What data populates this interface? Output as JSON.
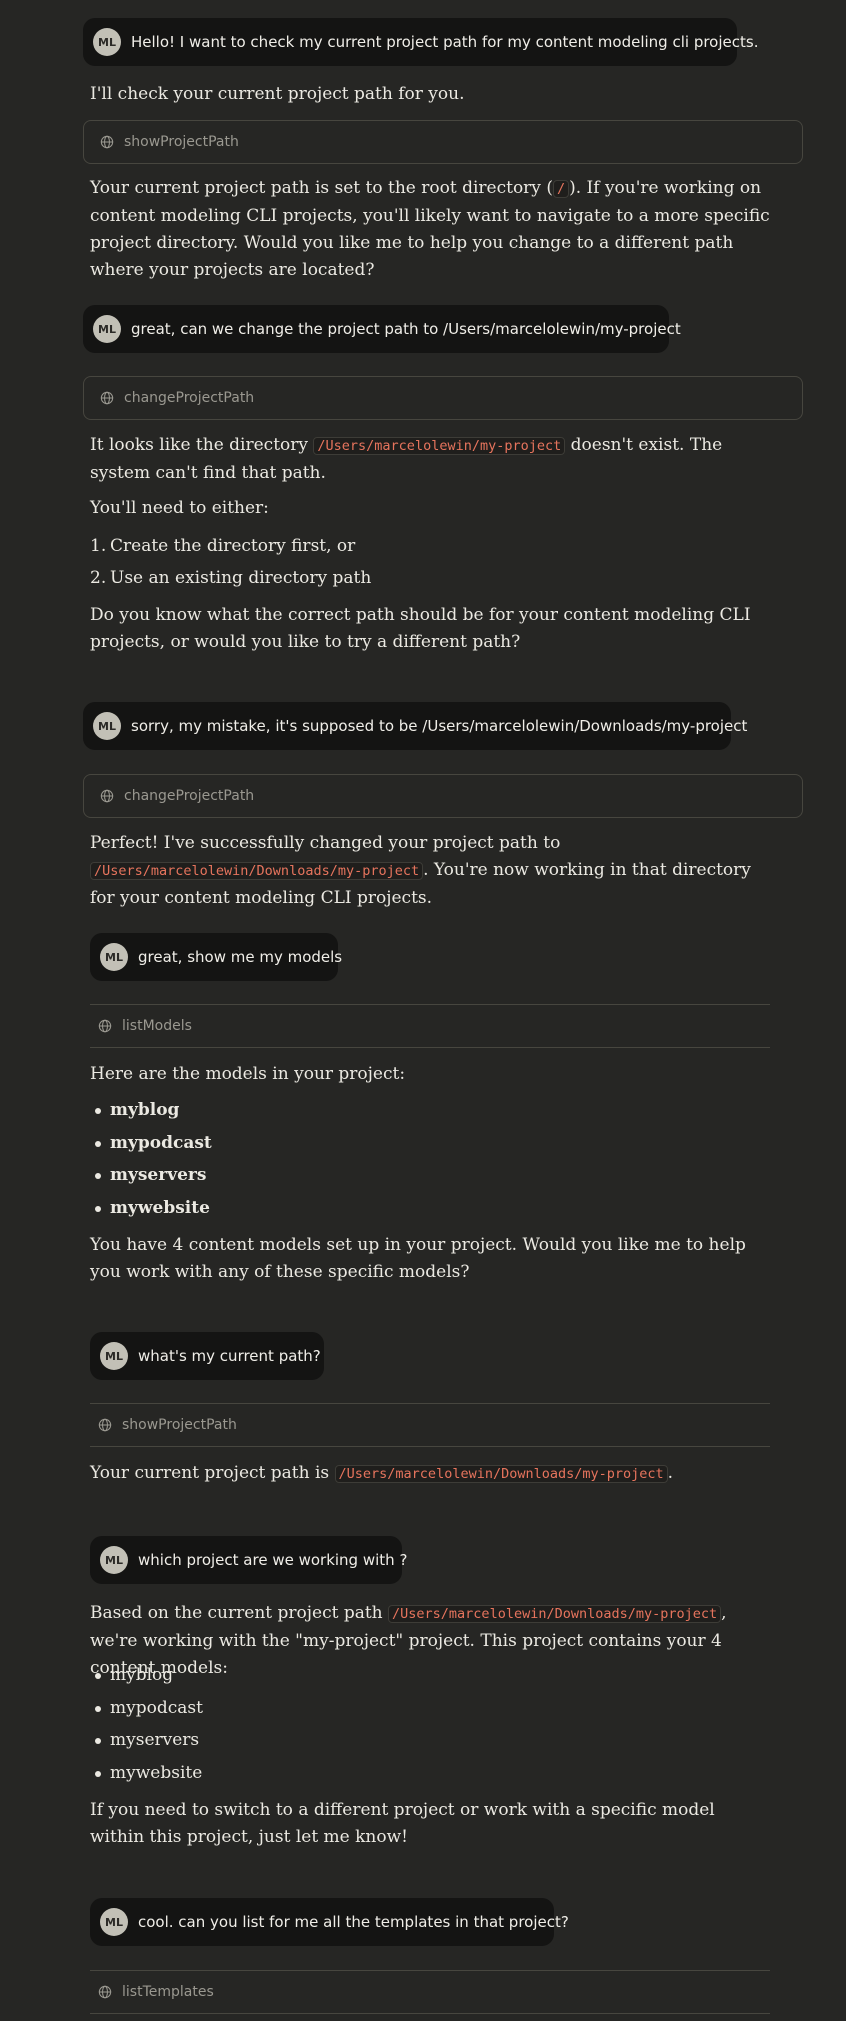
{
  "user": {
    "initials": "ML"
  },
  "messages": {
    "m1": "Hello!  I want to check my current project path for my content modeling cli projects.",
    "m2": "great, can we change the project path to /Users/marcelolewin/my-project",
    "m3": "sorry, my mistake, it's supposed to be /Users/marcelolewin/Downloads/my-project",
    "m4": "great, show me my models",
    "m5": "what's my current path?",
    "m6": "which project are we working with ?",
    "m7": "cool.  can you list for me all the templates in that project?"
  },
  "tools": {
    "t1": "showProjectPath",
    "t2": "changeProjectPath",
    "t3": "changeProjectPath",
    "t4": "listModels",
    "t5": "showProjectPath",
    "t6": "listTemplates"
  },
  "responses": {
    "r1": "I'll check your current project path for you.",
    "r2_pre": "Your current project path is set to the root directory (",
    "r2_code": "/",
    "r2_post": "). If you're working on content modeling CLI projects, you'll likely want to navigate to a more specific project directory. Would you like me to help you change to a different path where your projects are located?",
    "r3_pre": "It looks like the directory ",
    "r3_code": "/Users/marcelolewin/my-project",
    "r3_post": " doesn't exist. The system can't find that path.",
    "r4": "You'll need to either:",
    "r4_items": [
      "Create the directory first, or",
      "Use an existing directory path"
    ],
    "r5": "Do you know what the correct path should be for your content modeling CLI projects, or would you like to try a different path?",
    "r6_pre": "Perfect! I've successfully changed your project path to ",
    "r6_code": "/Users/marcelolewin/Downloads/my-project",
    "r6_post": ". You're now working in that directory for your content modeling CLI projects.",
    "r7": "Here are the models in your project:",
    "models": [
      "myblog",
      "mypodcast",
      "myservers",
      "mywebsite"
    ],
    "r8": "You have 4 content models set up in your project. Would you like me to help you work with any of these specific models?",
    "r9_pre": "Your current project path is ",
    "r9_code": "/Users/marcelolewin/Downloads/my-project",
    "r9_post": ".",
    "r10_pre": "Based on the current project path ",
    "r10_code": "/Users/marcelolewin/Downloads/my-project",
    "r10_post": ", we're working with the \"my-project\" project. This project contains your 4 content models:",
    "r11": "If you need to switch to a different project or work with a specific model within this project, just let me know!"
  }
}
